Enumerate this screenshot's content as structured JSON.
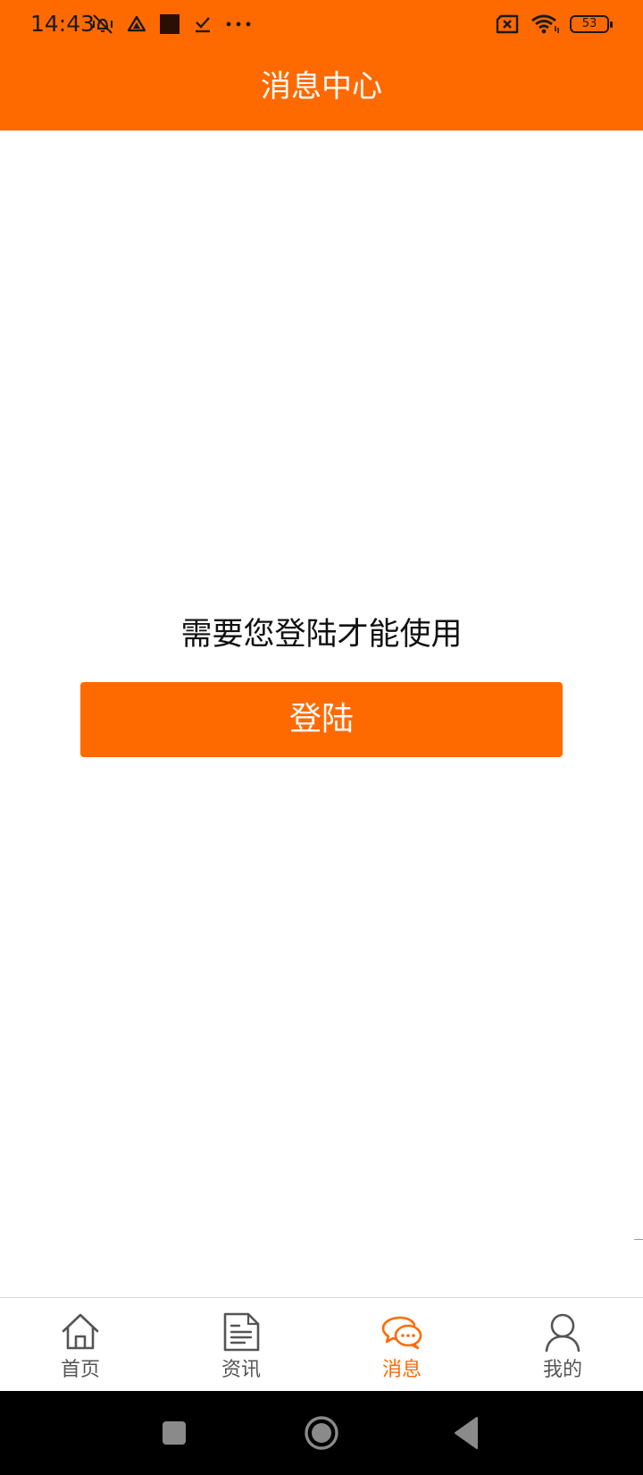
{
  "status_bar": {
    "time": "14:43",
    "battery_level": "53",
    "icons_left": [
      "vibrate-off-icon",
      "drive-icon",
      "square-notification-icon",
      "check-download-icon",
      "more-dots-icon"
    ],
    "icons_right": [
      "no-sim-icon",
      "wifi-icon",
      "battery-icon"
    ]
  },
  "header": {
    "title": "消息中心"
  },
  "main": {
    "prompt": "需要您登陆才能使用",
    "login_button": "登陆"
  },
  "tab_bar": {
    "tabs": [
      {
        "label": "首页",
        "icon": "home-icon",
        "active": false
      },
      {
        "label": "资讯",
        "icon": "document-icon",
        "active": false
      },
      {
        "label": "消息",
        "icon": "chat-bubbles-icon",
        "active": true
      },
      {
        "label": "我的",
        "icon": "user-icon",
        "active": false
      }
    ]
  },
  "nav_bar": {
    "buttons": [
      "recents-square-icon",
      "home-circle-icon",
      "back-triangle-icon"
    ]
  },
  "colors": {
    "accent": "#FF6A00",
    "status_text": "#1b1b1b",
    "tab_inactive": "#555555",
    "nav_bar": "#000000"
  }
}
